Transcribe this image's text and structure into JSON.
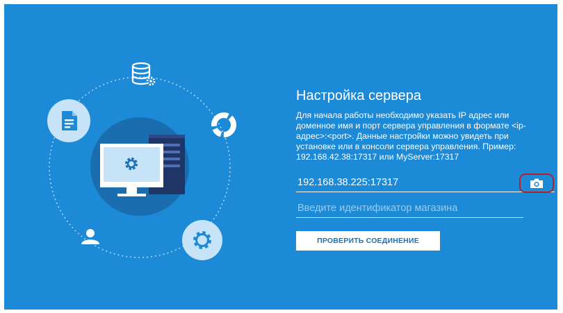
{
  "settings": {
    "title": "Настройка сервера",
    "description": "Для начала работы необходимо указать IP адрес или доменное имя и порт сервера управления в формате <ip-адрес>:<port>. Данные настройки можно увидеть при установке или в консоли сервера управления. Пример: 192.168.42.38:17317 или MyServer:17317",
    "server_address_value": "192.168.38.225:17317",
    "store_id_placeholder": "Введите идентификатор магазина",
    "check_connection_label": "ПРОВЕРИТЬ СОЕДИНЕНИЕ"
  },
  "icons": {
    "scan": "camera-icon",
    "illustration": [
      "database-gear-icon",
      "document-icon",
      "pie-chart-icon",
      "user-icon",
      "gear-icon",
      "computer-gear-icon",
      "server-tower-icon"
    ]
  },
  "colors": {
    "background": "#1c8ad6",
    "highlight_border": "#b3202a",
    "button_text": "#1c6fb4"
  }
}
